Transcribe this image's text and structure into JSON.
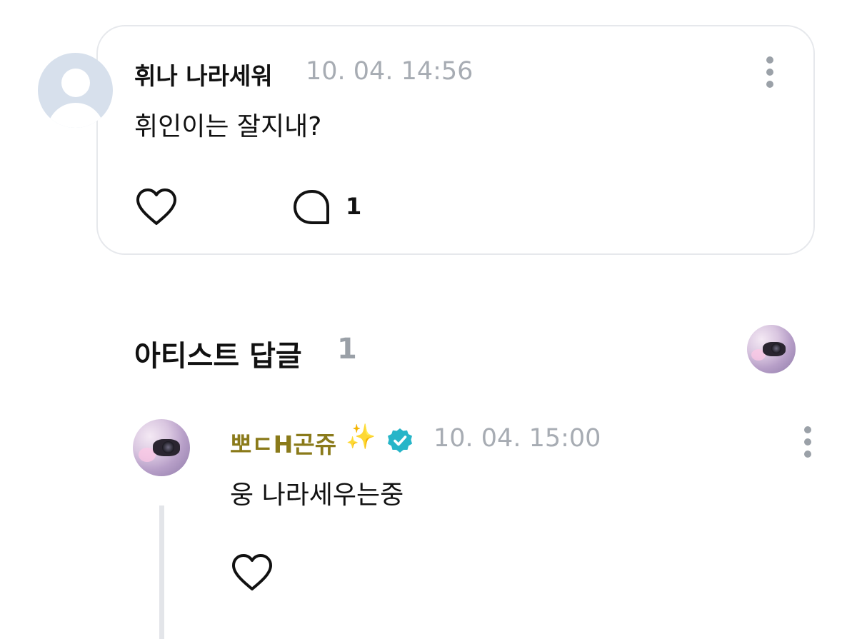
{
  "comment": {
    "author": "휘나 나라세워",
    "timestamp": "10. 04. 14:56",
    "text": "휘인이는 잘지내?",
    "reply_count": "1",
    "icons": {
      "avatar": "default-user-avatar-icon",
      "like": "heart-outline-icon",
      "reply": "speech-bubble-icon",
      "more": "kebab-menu-icon"
    }
  },
  "artist_replies": {
    "title": "아티스트 답글",
    "count": "1",
    "reply": {
      "author": "뽀ㄷH곤쥬",
      "author_emoji": "✨",
      "timestamp": "10. 04. 15:00",
      "text": "웅 나라세우는중",
      "icons": {
        "verified": "verified-badge-icon",
        "like": "heart-outline-icon",
        "more": "kebab-menu-icon"
      }
    }
  },
  "colors": {
    "card_border": "#e6e8ec",
    "timestamp": "#a7acb3",
    "artist_name": "#8a7a1a",
    "verified_badge": "#26b5c8",
    "thread_line": "#e3e5e9",
    "default_avatar": "#d7e0ec"
  }
}
